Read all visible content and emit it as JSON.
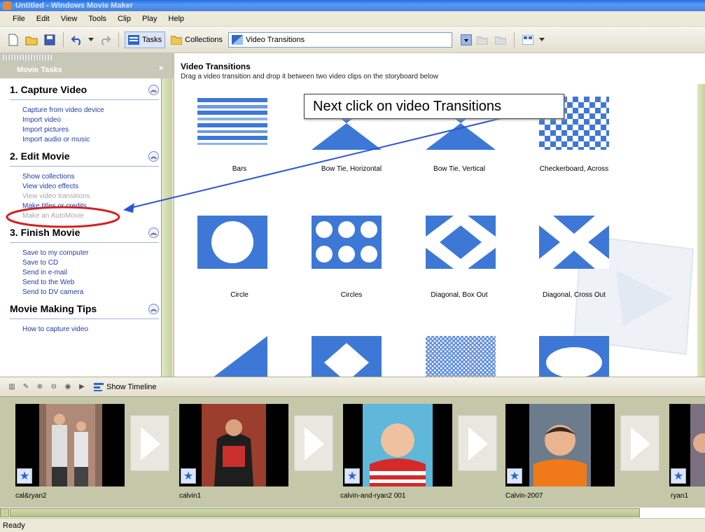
{
  "window": {
    "title": "Untitled - Windows Movie Maker"
  },
  "menu": [
    "File",
    "Edit",
    "View",
    "Tools",
    "Clip",
    "Play",
    "Help"
  ],
  "toolbar": {
    "tasks_label": "Tasks",
    "collections_label": "Collections",
    "location_value": "Video Transitions"
  },
  "tasks_pane": {
    "header": "Movie Tasks",
    "close": "×",
    "sections": [
      {
        "title": "1. Capture Video",
        "links": [
          "Capture from video device",
          "Import video",
          "Import pictures",
          "Import audio or music"
        ]
      },
      {
        "title": "2. Edit Movie",
        "links": [
          "Show collections",
          "View video effects",
          "View video transitions",
          "Make titles or credits",
          "Make an AutoMovie"
        ]
      },
      {
        "title": "3. Finish Movie",
        "links": [
          "Save to my computer",
          "Save to CD",
          "Send in e-mail",
          "Send to the Web",
          "Send to DV camera"
        ]
      },
      {
        "title": "Movie Making Tips",
        "links": [
          "How to capture video"
        ]
      }
    ]
  },
  "content": {
    "title": "Video Transitions",
    "subtitle": "Drag a video transition and drop it between two video clips on the storyboard below",
    "callout": "Next click on video Transitions",
    "transitions": [
      "Bars",
      "Bow Tie, Horizontal",
      "Bow Tie, Vertical",
      "Checkerboard, Across",
      "Circle",
      "Circles",
      "Diagonal, Box Out",
      "Diagonal, Cross Out"
    ]
  },
  "storyboard": {
    "show_timeline": "Show Timeline",
    "clips": [
      "cal&ryan2",
      "calvin1",
      "calvin-and-ryan2 001",
      "Calvin-2007",
      "ryan1"
    ]
  },
  "status": "Ready",
  "colors": {
    "accent": "#3A6FD8",
    "annotation": "#D42020",
    "arrow": "#2B55D6"
  }
}
